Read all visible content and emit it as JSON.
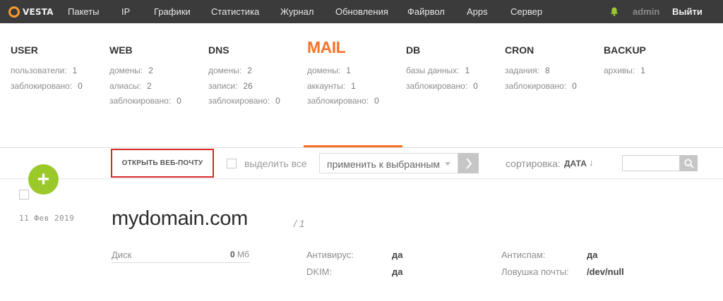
{
  "brand": {
    "logo_text": "VESTA",
    "accent": "#f79b28"
  },
  "nav": {
    "items": [
      {
        "label": "Пакеты"
      },
      {
        "label": "IP"
      },
      {
        "label": "Графики"
      },
      {
        "label": "Статистика"
      },
      {
        "label": "Журнал"
      },
      {
        "label": "Обновления"
      },
      {
        "label": "Файрвол"
      },
      {
        "label": "Apps"
      },
      {
        "label": "Сервер"
      }
    ],
    "notification_icon": "bell-icon",
    "user": "admin",
    "logout": "Выйти"
  },
  "stats": [
    {
      "title": "USER",
      "active": false,
      "rows": [
        {
          "label": "пользователи:",
          "value": "1"
        },
        {
          "label": "заблокировано:",
          "value": "0"
        }
      ]
    },
    {
      "title": "WEB",
      "active": false,
      "rows": [
        {
          "label": "домены:",
          "value": "2"
        },
        {
          "label": "алиасы:",
          "value": "2"
        },
        {
          "label": "заблокировано:",
          "value": "0"
        }
      ]
    },
    {
      "title": "DNS",
      "active": false,
      "rows": [
        {
          "label": "домены:",
          "value": "2"
        },
        {
          "label": "записи:",
          "value": "26"
        },
        {
          "label": "заблокировано:",
          "value": "0"
        }
      ]
    },
    {
      "title": "MAIL",
      "active": true,
      "rows": [
        {
          "label": "домены:",
          "value": "1"
        },
        {
          "label": "аккаунты:",
          "value": "1"
        },
        {
          "label": "заблокировано:",
          "value": "0"
        }
      ]
    },
    {
      "title": "DB",
      "active": false,
      "rows": [
        {
          "label": "базы данных:",
          "value": "1"
        },
        {
          "label": "заблокировано:",
          "value": "0"
        }
      ]
    },
    {
      "title": "CRON",
      "active": false,
      "rows": [
        {
          "label": "задания:",
          "value": "8"
        },
        {
          "label": "заблокировано:",
          "value": "0"
        }
      ]
    },
    {
      "title": "BACKUP",
      "active": false,
      "rows": [
        {
          "label": "архивы:",
          "value": "1"
        }
      ]
    }
  ],
  "toolbar": {
    "webmail_label": "ОТКРЫТЬ ВЕБ-ПОЧТУ",
    "select_all_label": "выделить все",
    "bulk_action": "применить к выбранным",
    "sort_label": "сортировка:",
    "sort_value": "ДАТА",
    "sort_arrow": "↓",
    "search_value": ""
  },
  "add_button": {
    "label": "+",
    "color": "#9bc92a"
  },
  "domains": [
    {
      "date": "11 Фев 2019",
      "name": "mydomain.com",
      "count": "/ 1",
      "disk_label": "Диск",
      "disk_value": "0",
      "disk_unit": "Мб",
      "antivirus_label": "Антивирус:",
      "antivirus_value": "да",
      "dkim_label": "DKIM:",
      "dkim_value": "да",
      "antispam_label": "Антиспам:",
      "antispam_value": "да",
      "catchall_label": "Ловушка почты:",
      "catchall_value": "/dev/null"
    }
  ]
}
